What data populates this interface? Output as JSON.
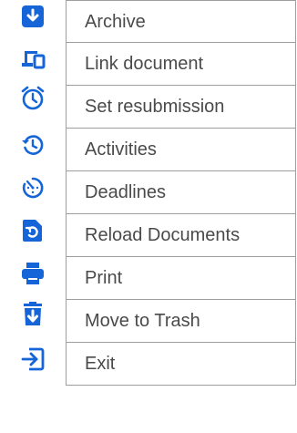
{
  "accent_color": "#1565d8",
  "menu": {
    "items": [
      {
        "icon": "archive-download-icon",
        "label": "Archive"
      },
      {
        "icon": "devices-link-icon",
        "label": "Link document"
      },
      {
        "icon": "alarm-clock-icon",
        "label": "Set resubmission"
      },
      {
        "icon": "history-icon",
        "label": "Activities"
      },
      {
        "icon": "timer-icon",
        "label": "Deadlines"
      },
      {
        "icon": "file-reload-icon",
        "label": "Reload Documents"
      },
      {
        "icon": "printer-icon",
        "label": "Print"
      },
      {
        "icon": "trash-download-icon",
        "label": "Move to Trash"
      },
      {
        "icon": "exit-icon",
        "label": "Exit"
      }
    ]
  }
}
